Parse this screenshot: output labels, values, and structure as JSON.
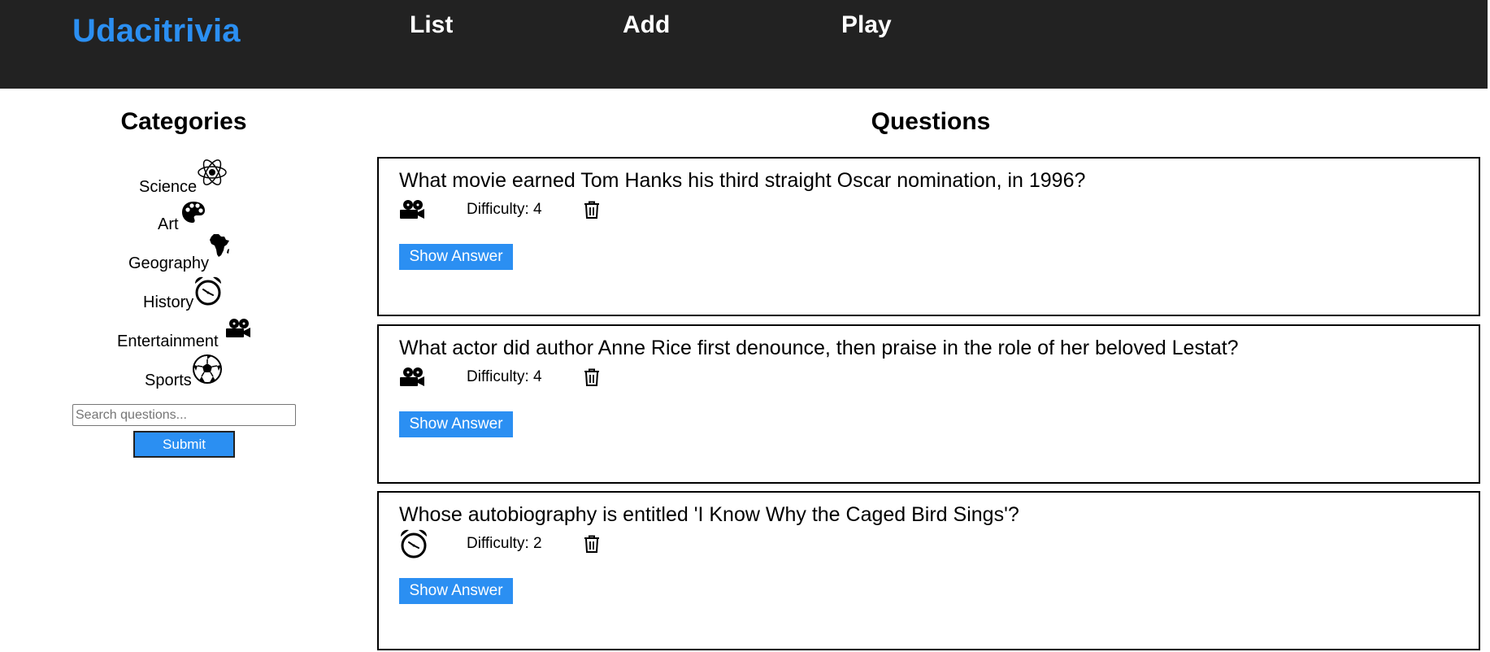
{
  "header": {
    "brand": "Udacitrivia",
    "nav": [
      {
        "label": "List"
      },
      {
        "label": "Add"
      },
      {
        "label": "Play"
      }
    ]
  },
  "colors": {
    "accent": "#2b8ff2",
    "header_bg": "#222222"
  },
  "sidebar": {
    "title": "Categories",
    "categories": [
      {
        "label": "Science",
        "icon": "atom-icon"
      },
      {
        "label": "Art",
        "icon": "palette-icon"
      },
      {
        "label": "Geography",
        "icon": "africa-icon"
      },
      {
        "label": "History",
        "icon": "alarm-clock-icon"
      },
      {
        "label": "Entertainment",
        "icon": "film-projector-icon"
      },
      {
        "label": "Sports",
        "icon": "soccer-ball-icon"
      }
    ],
    "search_placeholder": "Search questions...",
    "submit_label": "Submit"
  },
  "main": {
    "title": "Questions",
    "questions": [
      {
        "text": "What movie earned Tom Hanks his third straight Oscar nomination, in 1996?",
        "category_icon": "film-projector-icon",
        "difficulty": "Difficulty: 4",
        "show_label": "Show Answer"
      },
      {
        "text": "What actor did author Anne Rice first denounce, then praise in the role of her beloved Lestat?",
        "category_icon": "film-projector-icon",
        "difficulty": "Difficulty: 4",
        "show_label": "Show Answer"
      },
      {
        "text": "Whose autobiography is entitled 'I Know Why the Caged Bird Sings'?",
        "category_icon": "alarm-clock-icon",
        "difficulty": "Difficulty: 2",
        "show_label": "Show Answer"
      }
    ]
  }
}
